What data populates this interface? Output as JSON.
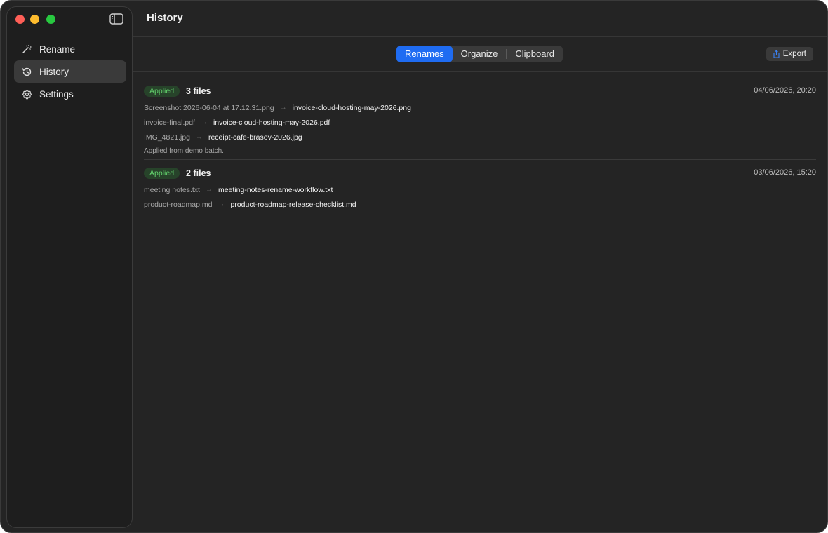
{
  "sidebar": {
    "items": [
      {
        "label": "Rename",
        "icon": "magic-wand-icon"
      },
      {
        "label": "History",
        "icon": "clock-history-icon",
        "active": true
      },
      {
        "label": "Settings",
        "icon": "gear-icon"
      }
    ]
  },
  "header": {
    "title": "History"
  },
  "tabs": [
    {
      "label": "Renames",
      "active": true
    },
    {
      "label": "Organize"
    },
    {
      "label": "Clipboard"
    }
  ],
  "toolbar": {
    "export_label": "Export"
  },
  "entries": [
    {
      "status": "Applied",
      "count": "3 files",
      "date": "04/06/2026, 20:20",
      "rows": [
        {
          "old": "Screenshot 2026-06-04 at 17.12.31.png",
          "new": "invoice-cloud-hosting-may-2026.png"
        },
        {
          "old": "invoice-final.pdf",
          "new": "invoice-cloud-hosting-may-2026.pdf"
        },
        {
          "old": "IMG_4821.jpg",
          "new": "receipt-cafe-brasov-2026.jpg"
        }
      ],
      "note": "Applied from demo batch."
    },
    {
      "status": "Applied",
      "count": "2 files",
      "date": "03/06/2026, 15:20",
      "rows": [
        {
          "old": "meeting notes.txt",
          "new": "meeting-notes-rename-workflow.txt"
        },
        {
          "old": "product-roadmap.md",
          "new": "product-roadmap-release-checklist.md"
        }
      ]
    }
  ],
  "colors": {
    "accent": "#1f6cf2",
    "applied_badge_bg": "#27432a",
    "applied_badge_text": "#62d16c"
  }
}
